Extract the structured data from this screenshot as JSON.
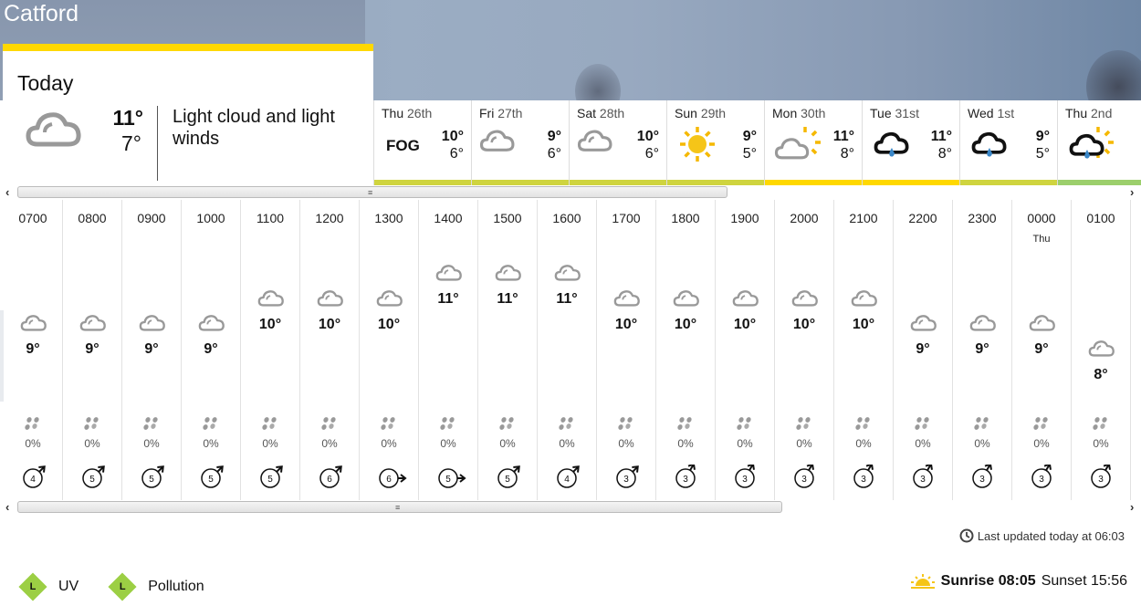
{
  "location": "Catford",
  "today": {
    "title": "Today",
    "icon": "light-cloud-icon",
    "high": "11°",
    "low": "7°",
    "description": "Light cloud and light winds",
    "bar_color": "#ffd800"
  },
  "days": [
    {
      "weekday": "Thu",
      "date": "26th",
      "icon": "fog-text",
      "icon_text": "FOG",
      "high": "10°",
      "low": "6°",
      "bar_color": "#cfd43f"
    },
    {
      "weekday": "Fri",
      "date": "27th",
      "icon": "light-cloud-icon",
      "high": "9°",
      "low": "6°",
      "bar_color": "#cfd43f"
    },
    {
      "weekday": "Sat",
      "date": "28th",
      "icon": "light-cloud-icon",
      "high": "10°",
      "low": "6°",
      "bar_color": "#cfd43f"
    },
    {
      "weekday": "Sun",
      "date": "29th",
      "icon": "sunny-icon",
      "high": "9°",
      "low": "5°",
      "bar_color": "#cfd43f"
    },
    {
      "weekday": "Mon",
      "date": "30th",
      "icon": "sunny-intervals-icon",
      "high": "11°",
      "low": "8°",
      "bar_color": "#ffd800"
    },
    {
      "weekday": "Tue",
      "date": "31st",
      "icon": "light-rain-icon",
      "high": "11°",
      "low": "8°",
      "bar_color": "#ffd800"
    },
    {
      "weekday": "Wed",
      "date": "1st",
      "icon": "light-rain-icon",
      "high": "9°",
      "low": "5°",
      "bar_color": "#cfd43f"
    },
    {
      "weekday": "Thu",
      "date": "2nd",
      "icon": "light-rain-showers-icon",
      "high": "",
      "low": "",
      "bar_color": "#9ccf6c"
    }
  ],
  "hours": [
    {
      "time": "0700",
      "day": "",
      "icon": "light-cloud-icon",
      "temp": "9°",
      "rain": "0%",
      "wind": "4",
      "wind_dir": "ne"
    },
    {
      "time": "0800",
      "day": "",
      "icon": "light-cloud-icon",
      "temp": "9°",
      "rain": "0%",
      "wind": "5",
      "wind_dir": "ne"
    },
    {
      "time": "0900",
      "day": "",
      "icon": "light-cloud-icon",
      "temp": "9°",
      "rain": "0%",
      "wind": "5",
      "wind_dir": "ne"
    },
    {
      "time": "1000",
      "day": "",
      "icon": "light-cloud-icon",
      "temp": "9°",
      "rain": "0%",
      "wind": "5",
      "wind_dir": "ne"
    },
    {
      "time": "1100",
      "day": "",
      "icon": "light-cloud-icon",
      "temp": "10°",
      "rain": "0%",
      "wind": "5",
      "wind_dir": "ne"
    },
    {
      "time": "1200",
      "day": "",
      "icon": "light-cloud-icon",
      "temp": "10°",
      "rain": "0%",
      "wind": "6",
      "wind_dir": "ne"
    },
    {
      "time": "1300",
      "day": "",
      "icon": "light-cloud-icon",
      "temp": "10°",
      "rain": "0%",
      "wind": "6",
      "wind_dir": "e"
    },
    {
      "time": "1400",
      "day": "",
      "icon": "light-cloud-icon",
      "temp": "11°",
      "rain": "0%",
      "wind": "5",
      "wind_dir": "e"
    },
    {
      "time": "1500",
      "day": "",
      "icon": "light-cloud-icon",
      "temp": "11°",
      "rain": "0%",
      "wind": "5",
      "wind_dir": "ne"
    },
    {
      "time": "1600",
      "day": "",
      "icon": "light-cloud-icon",
      "temp": "11°",
      "rain": "0%",
      "wind": "4",
      "wind_dir": "ne"
    },
    {
      "time": "1700",
      "day": "",
      "icon": "light-cloud-icon",
      "temp": "10°",
      "rain": "0%",
      "wind": "3",
      "wind_dir": "ne"
    },
    {
      "time": "1800",
      "day": "",
      "icon": "light-cloud-icon",
      "temp": "10°",
      "rain": "0%",
      "wind": "3",
      "wind_dir": "nne"
    },
    {
      "time": "1900",
      "day": "",
      "icon": "light-cloud-icon",
      "temp": "10°",
      "rain": "0%",
      "wind": "3",
      "wind_dir": "nne"
    },
    {
      "time": "2000",
      "day": "",
      "icon": "light-cloud-icon",
      "temp": "10°",
      "rain": "0%",
      "wind": "3",
      "wind_dir": "nne"
    },
    {
      "time": "2100",
      "day": "",
      "icon": "light-cloud-icon",
      "temp": "10°",
      "rain": "0%",
      "wind": "3",
      "wind_dir": "nne"
    },
    {
      "time": "2200",
      "day": "",
      "icon": "light-cloud-icon",
      "temp": "9°",
      "rain": "0%",
      "wind": "3",
      "wind_dir": "nne"
    },
    {
      "time": "2300",
      "day": "",
      "icon": "light-cloud-icon",
      "temp": "9°",
      "rain": "0%",
      "wind": "3",
      "wind_dir": "nne"
    },
    {
      "time": "0000",
      "day": "Thu",
      "icon": "light-cloud-icon",
      "temp": "9°",
      "rain": "0%",
      "wind": "3",
      "wind_dir": "nne"
    },
    {
      "time": "0100",
      "day": "",
      "icon": "light-cloud-icon",
      "temp": "8°",
      "rain": "0%",
      "wind": "3",
      "wind_dir": "nne"
    }
  ],
  "footer": {
    "last_updated": "Last updated today at 06:03",
    "uv_level": "L",
    "uv_label": "UV",
    "pollution_level": "L",
    "pollution_label": "Pollution",
    "sunrise": "Sunrise 08:05",
    "sunset": "Sunset 15:56"
  },
  "scrollbar": {
    "left_arrow": "‹",
    "right_arrow": "›",
    "grip": "≡"
  }
}
